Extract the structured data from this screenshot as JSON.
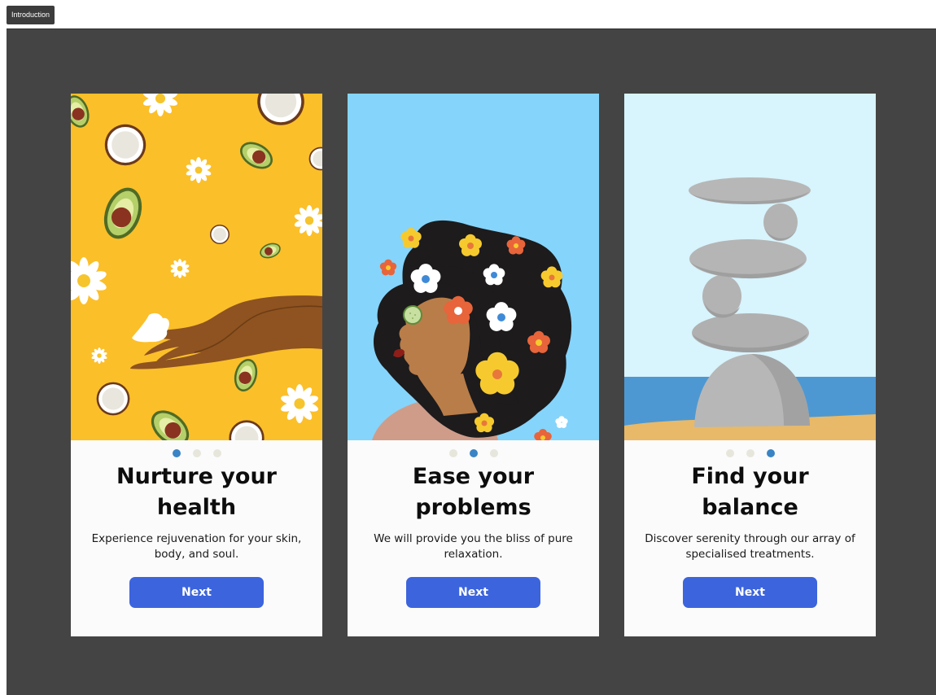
{
  "frame": {
    "label": "Introduction"
  },
  "colors": {
    "canvas": "#444444",
    "button": "#3c64dd",
    "dot_active": "#3a84c5",
    "dot_inactive": "#e7e6dc",
    "card1_bg": "#fbbf2a",
    "card2_bg": "#85d4fb",
    "card3_bg": "#d8f4fd"
  },
  "cards": [
    {
      "illustration": "hand-with-cream-avocado-coconut-daisy-pattern",
      "title_line1": "Nurture your",
      "title_line2": "health",
      "description": "Experience rejuvenation for your skin, body, and soul.",
      "button_label": "Next",
      "page_index": 1,
      "page_count": 3
    },
    {
      "illustration": "woman-with-flowers-in-hair-cucumber-eye",
      "title_line1": "Ease your",
      "title_line2": "problems",
      "description": "We will provide you the bliss of pure relaxation.",
      "button_label": "Next",
      "page_index": 2,
      "page_count": 3
    },
    {
      "illustration": "stacked-balance-stones-on-beach",
      "title_line1": "Find your",
      "title_line2": "balance",
      "description": "Discover serenity through our array of specialised treatments.",
      "button_label": "Next",
      "page_index": 3,
      "page_count": 3
    }
  ]
}
